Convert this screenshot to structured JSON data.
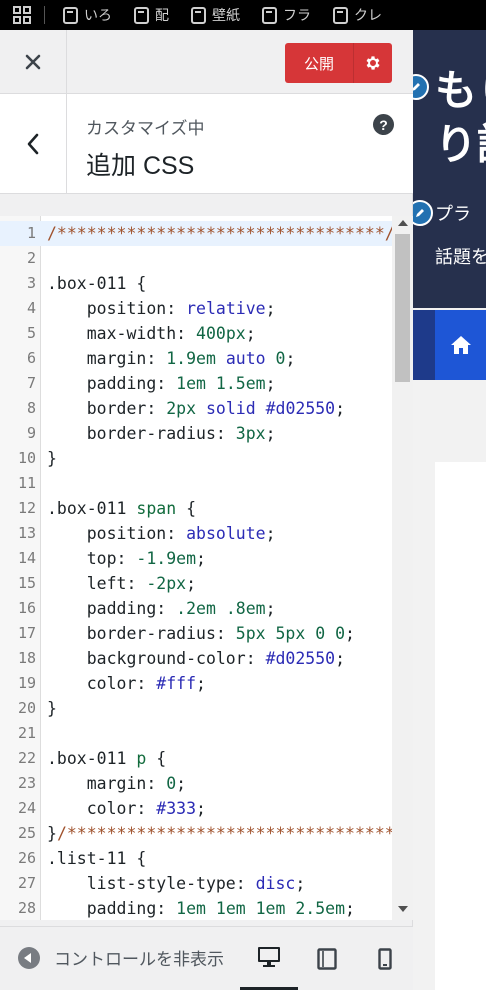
{
  "bookmarks": {
    "items": [
      {
        "label": "いろ"
      },
      {
        "label": "配"
      },
      {
        "label": "壁紙"
      },
      {
        "label": "フラ"
      },
      {
        "label": "クレ"
      }
    ]
  },
  "header": {
    "publish_label": "公開"
  },
  "section": {
    "breadcrumb": "カスタマイズ中",
    "title": "追加 CSS",
    "help": "?"
  },
  "editor": {
    "line_numbers": [
      "1",
      "2",
      "3",
      "4",
      "5",
      "6",
      "7",
      "8",
      "9",
      "10",
      "11",
      "12",
      "13",
      "14",
      "15",
      "16",
      "17",
      "18",
      "19",
      "20",
      "21",
      "22",
      "23",
      "24",
      "25",
      "26",
      "27",
      "28"
    ],
    "lines": [
      [
        {
          "t": "/*********************************/",
          "c": "com"
        }
      ],
      [],
      [
        {
          "t": ".box-011",
          "c": "sel"
        },
        {
          "t": " {",
          "c": "sel"
        }
      ],
      [
        {
          "t": "    position",
          "c": "prop"
        },
        {
          "t": ": ",
          "c": "prop"
        },
        {
          "t": "relative",
          "c": "val"
        },
        {
          "t": ";",
          "c": "prop"
        }
      ],
      [
        {
          "t": "    max-width",
          "c": "prop"
        },
        {
          "t": ": ",
          "c": "prop"
        },
        {
          "t": "400px",
          "c": "num"
        },
        {
          "t": ";",
          "c": "prop"
        }
      ],
      [
        {
          "t": "    margin",
          "c": "prop"
        },
        {
          "t": ": ",
          "c": "prop"
        },
        {
          "t": "1.9em",
          "c": "num"
        },
        {
          "t": " auto ",
          "c": "val"
        },
        {
          "t": "0",
          "c": "num"
        },
        {
          "t": ";",
          "c": "prop"
        }
      ],
      [
        {
          "t": "    padding",
          "c": "prop"
        },
        {
          "t": ": ",
          "c": "prop"
        },
        {
          "t": "1em 1.5em",
          "c": "num"
        },
        {
          "t": ";",
          "c": "prop"
        }
      ],
      [
        {
          "t": "    border",
          "c": "prop"
        },
        {
          "t": ": ",
          "c": "prop"
        },
        {
          "t": "2px",
          "c": "num"
        },
        {
          "t": " solid ",
          "c": "val"
        },
        {
          "t": "#d02550",
          "c": "hex"
        },
        {
          "t": ";",
          "c": "prop"
        }
      ],
      [
        {
          "t": "    border-radius",
          "c": "prop"
        },
        {
          "t": ": ",
          "c": "prop"
        },
        {
          "t": "3px",
          "c": "num"
        },
        {
          "t": ";",
          "c": "prop"
        }
      ],
      [
        {
          "t": "}",
          "c": "sel"
        }
      ],
      [],
      [
        {
          "t": ".box-011 ",
          "c": "sel"
        },
        {
          "t": "span",
          "c": "tag"
        },
        {
          "t": " {",
          "c": "sel"
        }
      ],
      [
        {
          "t": "    position",
          "c": "prop"
        },
        {
          "t": ": ",
          "c": "prop"
        },
        {
          "t": "absolute",
          "c": "val"
        },
        {
          "t": ";",
          "c": "prop"
        }
      ],
      [
        {
          "t": "    top",
          "c": "prop"
        },
        {
          "t": ": ",
          "c": "prop"
        },
        {
          "t": "-1.9em",
          "c": "num"
        },
        {
          "t": ";",
          "c": "prop"
        }
      ],
      [
        {
          "t": "    left",
          "c": "prop"
        },
        {
          "t": ": ",
          "c": "prop"
        },
        {
          "t": "-2px",
          "c": "num"
        },
        {
          "t": ";",
          "c": "prop"
        }
      ],
      [
        {
          "t": "    padding",
          "c": "prop"
        },
        {
          "t": ": ",
          "c": "prop"
        },
        {
          "t": ".2em .8em",
          "c": "num"
        },
        {
          "t": ";",
          "c": "prop"
        }
      ],
      [
        {
          "t": "    border-radius",
          "c": "prop"
        },
        {
          "t": ": ",
          "c": "prop"
        },
        {
          "t": "5px 5px 0 0",
          "c": "num"
        },
        {
          "t": ";",
          "c": "prop"
        }
      ],
      [
        {
          "t": "    background-color",
          "c": "prop"
        },
        {
          "t": ": ",
          "c": "prop"
        },
        {
          "t": "#d02550",
          "c": "hex"
        },
        {
          "t": ";",
          "c": "prop"
        }
      ],
      [
        {
          "t": "    color",
          "c": "prop"
        },
        {
          "t": ": ",
          "c": "prop"
        },
        {
          "t": "#fff",
          "c": "hex"
        },
        {
          "t": ";",
          "c": "prop"
        }
      ],
      [
        {
          "t": "}",
          "c": "sel"
        }
      ],
      [],
      [
        {
          "t": ".box-011 ",
          "c": "sel"
        },
        {
          "t": "p",
          "c": "tag"
        },
        {
          "t": " {",
          "c": "sel"
        }
      ],
      [
        {
          "t": "    margin",
          "c": "prop"
        },
        {
          "t": ": ",
          "c": "prop"
        },
        {
          "t": "0",
          "c": "num"
        },
        {
          "t": ";",
          "c": "prop"
        }
      ],
      [
        {
          "t": "    color",
          "c": "prop"
        },
        {
          "t": ": ",
          "c": "prop"
        },
        {
          "t": "#333",
          "c": "hex"
        },
        {
          "t": ";",
          "c": "prop"
        }
      ],
      [
        {
          "t": "}",
          "c": "sel"
        },
        {
          "t": "/*********************************/",
          "c": "com"
        }
      ],
      [
        {
          "t": ".list-11",
          "c": "sel"
        },
        {
          "t": " {",
          "c": "sel"
        }
      ],
      [
        {
          "t": "    list-style-type",
          "c": "prop"
        },
        {
          "t": ": ",
          "c": "prop"
        },
        {
          "t": "disc",
          "c": "val"
        },
        {
          "t": ";",
          "c": "prop"
        }
      ],
      [
        {
          "t": "    padding",
          "c": "prop"
        },
        {
          "t": ": ",
          "c": "prop"
        },
        {
          "t": "1em 1em 1em 2.5em",
          "c": "num"
        },
        {
          "t": ";",
          "c": "prop"
        }
      ]
    ]
  },
  "footer": {
    "collapse_label": "コントロールを非表示"
  },
  "preview": {
    "title": "もり",
    "title_line2": "り話",
    "subtitle": "プラ",
    "topic": "話題を"
  },
  "colors": {
    "publish": "#d63638",
    "preview_header": "#26304d",
    "preview_nav": "#1e56d6"
  }
}
